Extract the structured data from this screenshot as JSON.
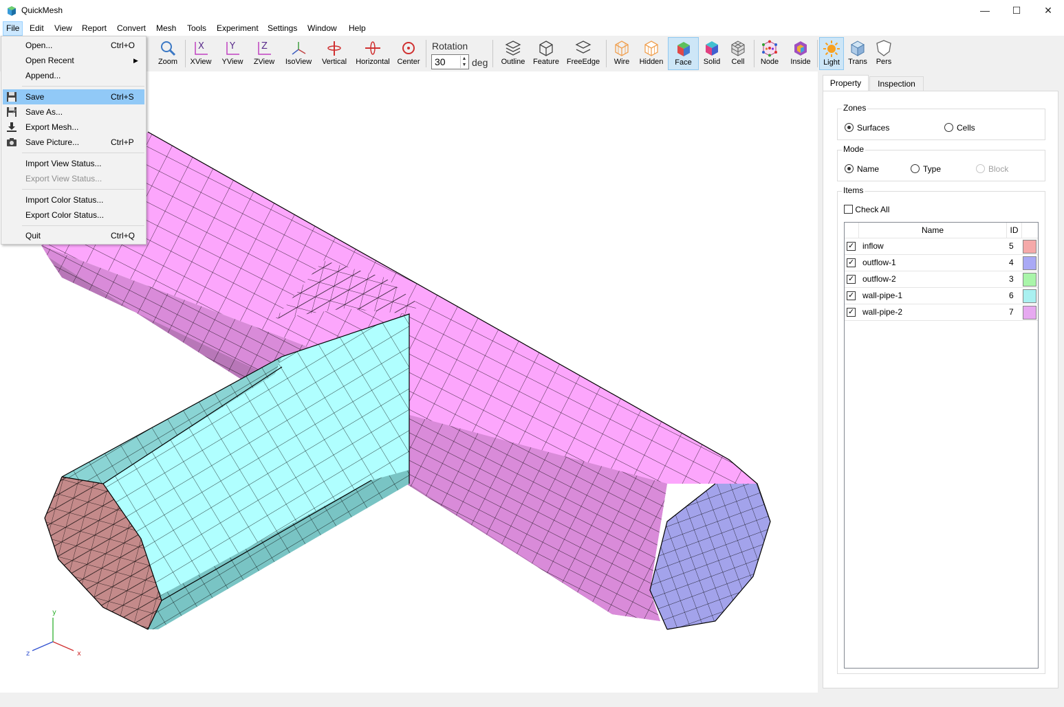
{
  "window": {
    "title": "QuickMesh",
    "controls": [
      "—",
      "☐",
      "✕"
    ]
  },
  "menubar": [
    "File",
    "Edit",
    "View",
    "Report",
    "Convert",
    "Mesh",
    "Tools",
    "Experiment",
    "Settings",
    "Window",
    "Help"
  ],
  "toolbar": {
    "zoom": "Zoom",
    "views": [
      "XView",
      "YView",
      "ZView",
      "IsoView",
      "Vertical",
      "Horizontal",
      "Center"
    ],
    "rotation_label": "Rotation",
    "rotation_value": "30",
    "rotation_unit": "deg",
    "display": [
      "Outline",
      "Feature",
      "FreeEdge"
    ],
    "render": [
      "Wire",
      "Hidden",
      "Face",
      "Solid",
      "Cell"
    ],
    "misc": [
      "Node",
      "Inside"
    ],
    "light": [
      "Light",
      "Trans",
      "Pers"
    ]
  },
  "file_menu": {
    "items": [
      {
        "label": "Open...",
        "shortcut": "Ctrl+O"
      },
      {
        "label": "Open Recent",
        "shortcut": ""
      },
      {
        "label": "Append...",
        "shortcut": ""
      },
      {
        "label": "Save",
        "shortcut": "Ctrl+S"
      },
      {
        "label": "Save As...",
        "shortcut": ""
      },
      {
        "label": "Export Mesh...",
        "shortcut": ""
      },
      {
        "label": "Save Picture...",
        "shortcut": "Ctrl+P"
      },
      {
        "label": "Import View Status...",
        "shortcut": ""
      },
      {
        "label": "Export View Status...",
        "shortcut": ""
      },
      {
        "label": "Import Color Status...",
        "shortcut": ""
      },
      {
        "label": "Export Color Status...",
        "shortcut": ""
      },
      {
        "label": "Quit",
        "shortcut": "Ctrl+Q"
      }
    ],
    "highlighted": "Save",
    "disabled": "Export View Status..."
  },
  "axes": {
    "x": "x",
    "y": "y",
    "z": "z"
  },
  "panel": {
    "tabs": [
      "Property",
      "Inspection"
    ],
    "zones": {
      "title": "Zones",
      "options": [
        "Surfaces",
        "Cells"
      ],
      "selected": "Surfaces"
    },
    "mode": {
      "title": "Mode",
      "options": [
        "Name",
        "Type",
        "Block"
      ],
      "selected": "Name",
      "disabled": "Block"
    },
    "items": {
      "title": "Items",
      "check_all": "Check All",
      "columns": [
        "Name",
        "ID"
      ],
      "rows": [
        {
          "name": "inflow",
          "id": "5",
          "color": "#f5a9a9",
          "checked": true
        },
        {
          "name": "outflow-1",
          "id": "4",
          "color": "#a9a9f5",
          "checked": true
        },
        {
          "name": "outflow-2",
          "id": "3",
          "color": "#a9f5a9",
          "checked": true
        },
        {
          "name": "wall-pipe-1",
          "id": "6",
          "color": "#a9f0f0",
          "checked": true
        },
        {
          "name": "wall-pipe-2",
          "id": "7",
          "color": "#e6a9f0",
          "checked": true
        }
      ]
    }
  },
  "colors": {
    "pipe2_top": "#fca6fc",
    "pipe2_side": "#d98bd9",
    "pipe1_top": "#b0ffff",
    "pipe1_side": "#79c4c4",
    "inflow": "#c48a8a",
    "outflow": "#a3a3eb"
  }
}
